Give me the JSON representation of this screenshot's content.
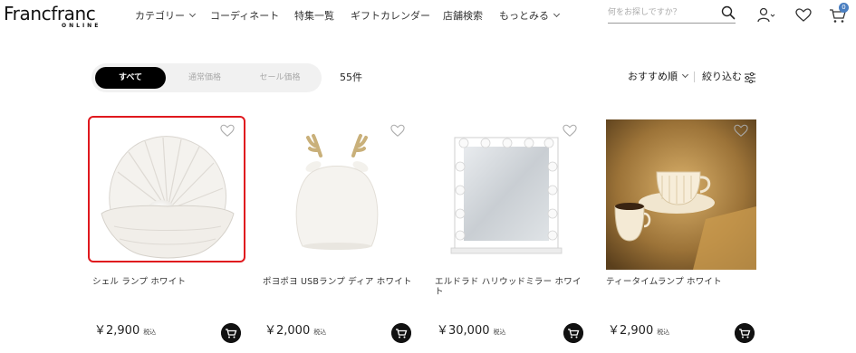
{
  "header": {
    "logo_main": "Francfranc",
    "logo_sub": "ONLINE",
    "nav": [
      {
        "label": "カテゴリー"
      },
      {
        "label": "コーディネート"
      },
      {
        "label": "特集一覧"
      },
      {
        "label": "ギフトカレンダー"
      },
      {
        "label": "店舗検索"
      },
      {
        "label": "もっとみる"
      }
    ],
    "search_placeholder": "何をお探しですか？",
    "cart_count": "0",
    "icons": [
      "search-icon",
      "user-icon",
      "heart-icon",
      "cart-icon"
    ],
    "badge_color": "#4a7fc1"
  },
  "filter": {
    "tabs": [
      {
        "label": "すべて"
      },
      {
        "label": "通常価格"
      },
      {
        "label": "セール価格"
      }
    ],
    "count": "55件",
    "sort_label": "おすすめ順",
    "filter_label": "絞り込む"
  },
  "products": [
    {
      "name": "シェル ランプ ホワイト",
      "price": "￥2,900",
      "tax": "税込"
    },
    {
      "name": "ポヨポヨ USBランプ ディア ホワイト",
      "price": "￥2,000",
      "tax": "税込"
    },
    {
      "name": "エルドラド ハリウッドミラー ホワイト",
      "price": "￥30,000",
      "tax": "税込"
    },
    {
      "name": "ティータイムランプ ホワイト",
      "price": "￥2,900",
      "tax": "税込"
    }
  ],
  "accent_color": "#e0191e"
}
